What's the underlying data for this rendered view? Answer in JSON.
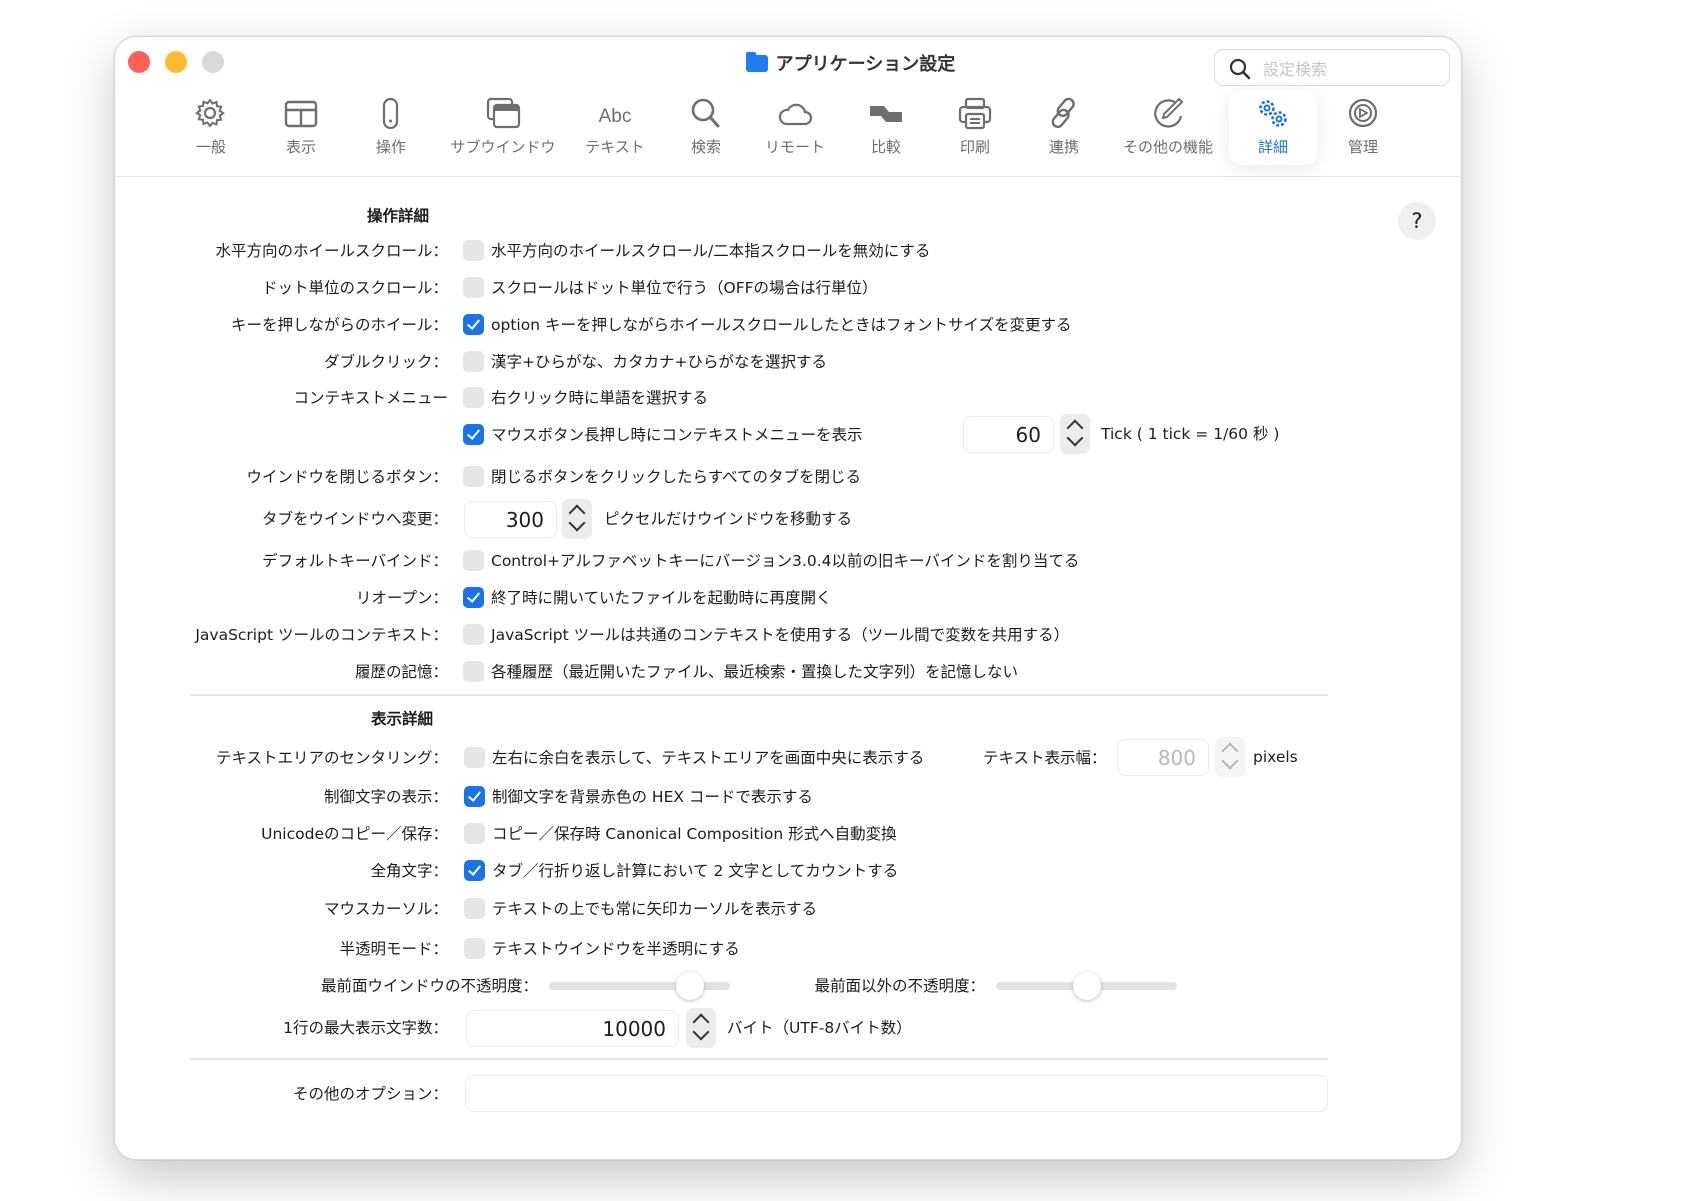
{
  "window": {
    "title": "アプリケーション設定",
    "search_placeholder": "設定検索"
  },
  "colors": {
    "accent": "#1a73e8",
    "close": "#fe5f57",
    "minimize": "#febc2e",
    "zoom_disabled": "#d9d9d9"
  },
  "toolbar": {
    "selected": "詳細",
    "items": [
      {
        "label": "一般",
        "icon": "gear-icon"
      },
      {
        "label": "表示",
        "icon": "layout-icon"
      },
      {
        "label": "操作",
        "icon": "mouse-icon"
      },
      {
        "label": "サブウインドウ",
        "icon": "windows-icon"
      },
      {
        "label": "テキスト",
        "icon": "abc-icon"
      },
      {
        "label": "検索",
        "icon": "magnifier-icon"
      },
      {
        "label": "リモート",
        "icon": "cloud-icon"
      },
      {
        "label": "比較",
        "icon": "compare-icon"
      },
      {
        "label": "印刷",
        "icon": "printer-icon"
      },
      {
        "label": "連携",
        "icon": "link-icon"
      },
      {
        "label": "その他の機能",
        "icon": "pencil-circle-icon"
      },
      {
        "label": "詳細",
        "icon": "gears-icon"
      },
      {
        "label": "管理",
        "icon": "admin-gear-icon"
      }
    ]
  },
  "help_label": "?",
  "sections": {
    "operation": "操作詳細",
    "display": "表示詳細"
  },
  "rows": [
    {
      "label": "水平方向のホイールスクロール：",
      "checked": false,
      "text": "水平方向のホイールスクロール/二本指スクロールを無効にする"
    },
    {
      "label": "ドット単位のスクロール：",
      "checked": false,
      "text": "スクロールはドット単位で行う（OFFの場合は行単位）"
    },
    {
      "label": "キーを押しながらのホイール：",
      "checked": true,
      "text": "option キーを押しながらホイールスクロールしたときはフォントサイズを変更する"
    },
    {
      "label": "ダブルクリック：",
      "checked": false,
      "text": "漢字+ひらがな、カタカナ+ひらがなを選択する"
    },
    {
      "label": "コンテキストメニュー",
      "checked": false,
      "text": "右クリック時に単語を選択する"
    },
    {
      "label": "",
      "checked": true,
      "text": "マウスボタン長押し時にコンテキストメニューを表示"
    },
    {
      "label": "ウインドウを閉じるボタン：",
      "checked": false,
      "text": "閉じるボタンをクリックしたらすべてのタブを閉じる"
    },
    {
      "label": "デフォルトキーバインド：",
      "checked": false,
      "text": "Control+アルファベットキーにバージョン3.0.4以前の旧キーバインドを割り当てる"
    },
    {
      "label": "リオープン：",
      "checked": true,
      "text": "終了時に開いていたファイルを起動時に再度開く"
    },
    {
      "label": "JavaScript ツールのコンテキスト：",
      "checked": false,
      "text": "JavaScript ツールは共通のコンテキストを使用する（ツール間で変数を共用する）"
    },
    {
      "label": "履歴の記憶：",
      "checked": false,
      "text": "各種履歴（最近開いたファイル、最近検索・置換した文字列）を記憶しない"
    },
    {
      "label": "テキストエリアのセンタリング：",
      "checked": false,
      "text": "左右に余白を表示して、テキストエリアを画面中央に表示する"
    },
    {
      "label": "制御文字の表示：",
      "checked": true,
      "text": "制御文字を背景赤色の HEX コードで表示する"
    },
    {
      "label": "Unicodeのコピー／保存：",
      "checked": false,
      "text": "コピー／保存時 Canonical Composition 形式へ自動変換"
    },
    {
      "label": "全角文字：",
      "checked": true,
      "text": "タブ／行折り返し計算において 2 文字としてカウントする"
    },
    {
      "label": "マウスカーソル：",
      "checked": false,
      "text": "テキストの上でも常に矢印カーソルを表示する"
    },
    {
      "label": "半透明モード：",
      "checked": false,
      "text": "テキストウインドウを半透明にする"
    }
  ],
  "long_press": {
    "value": "60",
    "unit": "Tick ( 1 tick = 1/60 秒 )"
  },
  "tab_to_window": {
    "label": "タブをウインドウへ変更：",
    "value": "300",
    "unit": "ピクセルだけウインドウを移動する"
  },
  "text_width": {
    "label": "テキスト表示幅：",
    "value": "800",
    "unit": "pixels",
    "enabled": false
  },
  "opacity": {
    "front_label": "最前面ウインドウの不透明度：",
    "front_value_percent": 78,
    "other_label": "最前面以外の不透明度：",
    "other_value_percent": 50
  },
  "max_chars": {
    "label": "1行の最大表示文字数：",
    "value": "10000",
    "unit": "バイト（UTF-8バイト数）"
  },
  "other_options": {
    "label": "その他のオプション：",
    "value": ""
  }
}
